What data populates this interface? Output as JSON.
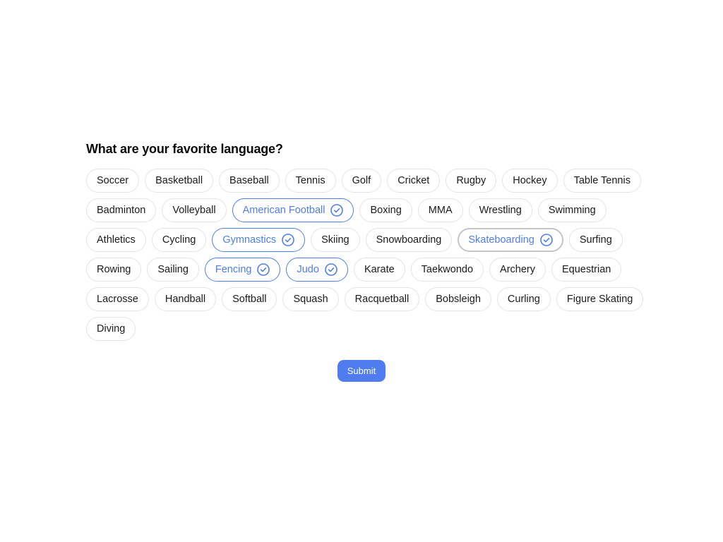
{
  "question": "What are your favorite language?",
  "options": [
    {
      "label": "Soccer",
      "selected": false
    },
    {
      "label": "Basketball",
      "selected": false
    },
    {
      "label": "Baseball",
      "selected": false
    },
    {
      "label": "Tennis",
      "selected": false
    },
    {
      "label": "Golf",
      "selected": false
    },
    {
      "label": "Cricket",
      "selected": false
    },
    {
      "label": "Rugby",
      "selected": false
    },
    {
      "label": "Hockey",
      "selected": false
    },
    {
      "label": "Table Tennis",
      "selected": false
    },
    {
      "label": "Badminton",
      "selected": false
    },
    {
      "label": "Volleyball",
      "selected": false
    },
    {
      "label": "American Football",
      "selected": true
    },
    {
      "label": "Boxing",
      "selected": false
    },
    {
      "label": "MMA",
      "selected": false
    },
    {
      "label": "Wrestling",
      "selected": false
    },
    {
      "label": "Swimming",
      "selected": false
    },
    {
      "label": "Athletics",
      "selected": false
    },
    {
      "label": "Cycling",
      "selected": false
    },
    {
      "label": "Gymnastics",
      "selected": true
    },
    {
      "label": "Skiing",
      "selected": false
    },
    {
      "label": "Snowboarding",
      "selected": false
    },
    {
      "label": "Skateboarding",
      "selected": true,
      "focused": true
    },
    {
      "label": "Surfing",
      "selected": false
    },
    {
      "label": "Rowing",
      "selected": false
    },
    {
      "label": "Sailing",
      "selected": false
    },
    {
      "label": "Fencing",
      "selected": true
    },
    {
      "label": "Judo",
      "selected": true
    },
    {
      "label": "Karate",
      "selected": false
    },
    {
      "label": "Taekwondo",
      "selected": false
    },
    {
      "label": "Archery",
      "selected": false
    },
    {
      "label": "Equestrian",
      "selected": false
    },
    {
      "label": "Lacrosse",
      "selected": false
    },
    {
      "label": "Handball",
      "selected": false
    },
    {
      "label": "Softball",
      "selected": false
    },
    {
      "label": "Squash",
      "selected": false
    },
    {
      "label": "Racquetball",
      "selected": false
    },
    {
      "label": "Bobsleigh",
      "selected": false
    },
    {
      "label": "Curling",
      "selected": false
    },
    {
      "label": "Figure Skating",
      "selected": false
    },
    {
      "label": "Diving",
      "selected": false
    }
  ],
  "selected_icon": "check-circle-icon",
  "submit_label": "Submit",
  "colors": {
    "accent": "#4f7df0",
    "chip_border": "#e4e4e4",
    "focus_ring": "#c4c4c4",
    "text": "#1a1a1a"
  }
}
